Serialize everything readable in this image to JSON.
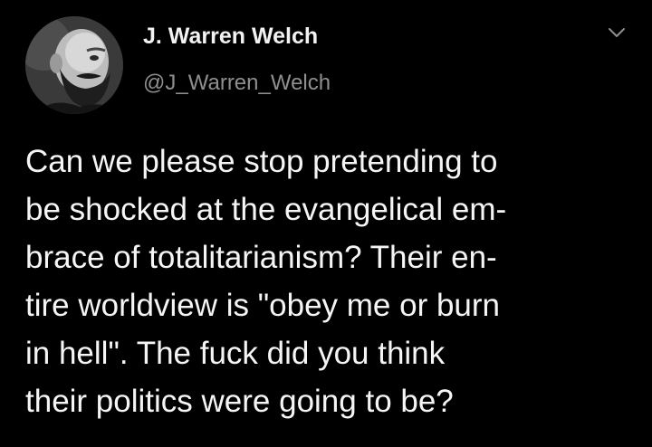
{
  "author": {
    "display_name": "J. Warren Welch",
    "handle": "@J_Warren_Welch",
    "avatar_icon": "profile-photo"
  },
  "menu_icon": "chevron-down-icon",
  "tweet": {
    "lines": [
      "Can we please stop pretending to",
      "be shocked at the evangelical em-",
      "brace of totalitarianism? Their en-",
      "tire worldview is \"obey me or burn",
      "in hell\". The fuck did you think",
      "their politics were going to be?"
    ]
  },
  "colors": {
    "background": "#000000",
    "name": "#f2f2f2",
    "handle": "#8f8f8f",
    "text": "#f5f5f5"
  }
}
